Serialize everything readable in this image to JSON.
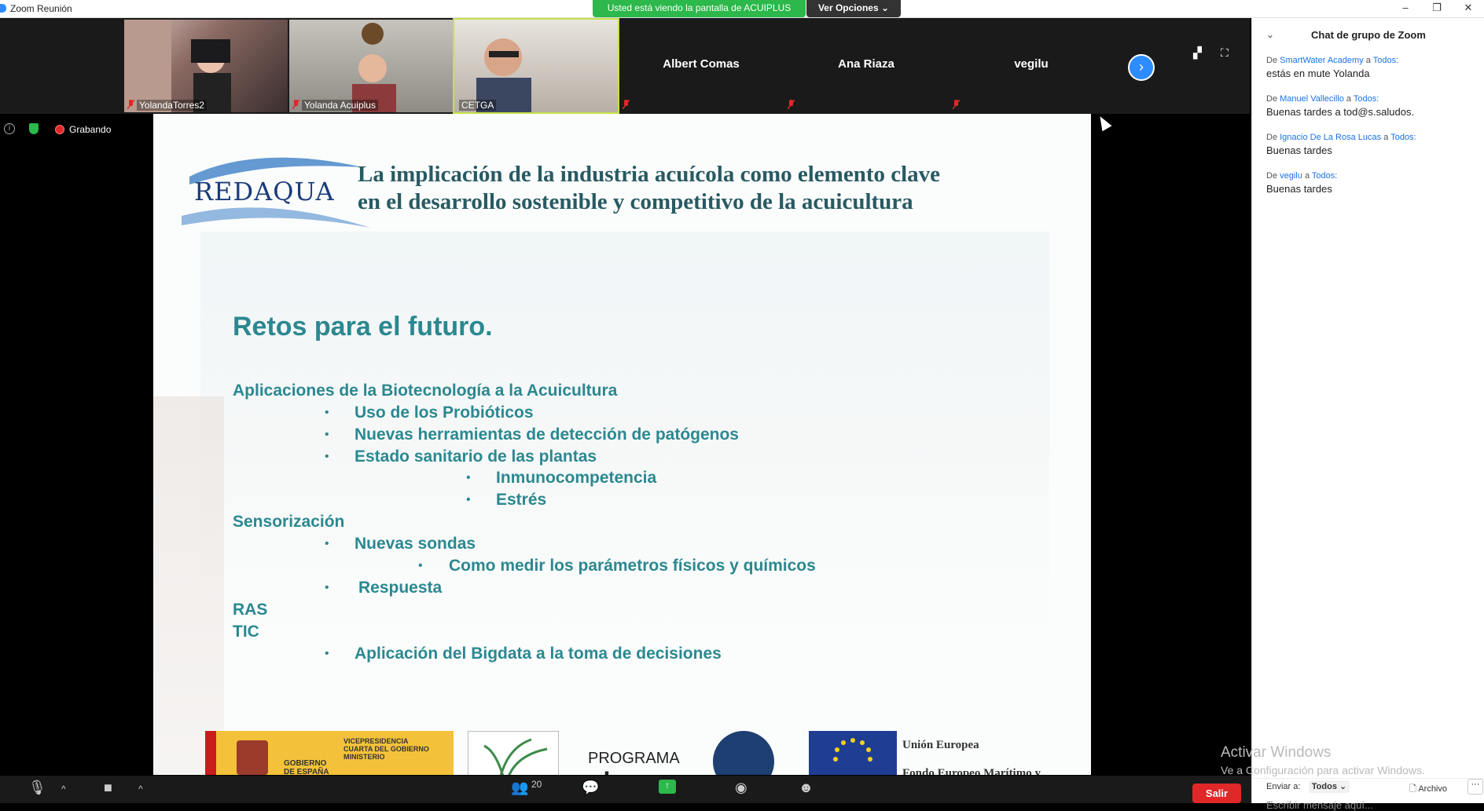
{
  "window": {
    "title": "Zoom Reunión",
    "minimize": "–",
    "restore": "❐",
    "close": "✕"
  },
  "share_banner": {
    "text": "Usted está viendo la pantalla de ACUIPLUS",
    "options_label": "Ver Opciones"
  },
  "participants": [
    {
      "name": "YolandaTorres2",
      "video": true
    },
    {
      "name": "Yolanda Acuiplus",
      "video": true
    },
    {
      "name": "CETGA",
      "video": true,
      "active": true
    },
    {
      "name": "Albert Comas",
      "video": false
    },
    {
      "name": "Ana Riaza",
      "video": false
    },
    {
      "name": "vegilu",
      "video": false
    }
  ],
  "recording": {
    "label": "Grabando"
  },
  "slide": {
    "logo": "REDAQUA",
    "headline_1": "La implicación de la industria acuícola como elemento clave",
    "headline_2": "en el desarrollo sostenible y competitivo de la acuicultura",
    "heading": "Retos para el futuro.",
    "lines": [
      {
        "text": "Aplicaciones de la Biotecnología a la Acuicultura",
        "level": 0
      },
      {
        "text": "Uso de los Probióticos",
        "level": 1
      },
      {
        "text": "Nuevas herramientas de detección de patógenos",
        "level": 1
      },
      {
        "text": "Estado sanitario de las plantas",
        "level": 1
      },
      {
        "text": "Inmunocompetencia",
        "level": 2
      },
      {
        "text": "Estrés",
        "level": 2
      },
      {
        "text": "Sensorización",
        "level": 0
      },
      {
        "text": "Nuevas sondas",
        "level": 1
      },
      {
        "text": "Como medir los parámetros físicos y químicos",
        "level": 3
      },
      {
        "text": "Respuesta",
        "level": 1
      },
      {
        "text": "RAS",
        "level": 0
      },
      {
        "text": "TIC",
        "level": 0
      },
      {
        "text": "Aplicación  del Bigdata a la toma de decisiones",
        "level": 1
      }
    ],
    "footer": {
      "gob_1": "GOBIERNO\nDE ESPAÑA",
      "gob_2": "VICEPRESIDENCIA\nCUARTA DEL GOBIERNO\nMINISTERIO",
      "programa": "PROGRAMA",
      "pleamar": "pleamar",
      "eu_1": "Unión Europea",
      "eu_2": "Fondo Europeo Marítimo y"
    }
  },
  "chat": {
    "title": "Chat de grupo de Zoom",
    "messages": [
      {
        "from": "SmartWater Academy",
        "to": "Todos:",
        "text": "estás en mute Yolanda"
      },
      {
        "from": "Manuel Vallecillo",
        "to": "Todos:",
        "text": "Buenas tardes a tod@s.saludos."
      },
      {
        "from": "Ignacio De La Rosa Lucas",
        "to": "Todos:",
        "text": "Buenas tardes"
      },
      {
        "from": "vegilu",
        "to": "Todos:",
        "text": "Buenas tardes"
      }
    ],
    "from_prefix": "De",
    "to_word": "a",
    "send_to_label": "Enviar a:",
    "send_to_value": "Todos",
    "file_label": "Archivo",
    "more_label": "···",
    "placeholder": "Escribir mensaje aquí...",
    "watermark_1": "Activar Windows",
    "watermark_2": "Ve a Configuración para activar Windows."
  },
  "toolbar": {
    "participants_count": "20",
    "leave_label": "Salir"
  }
}
